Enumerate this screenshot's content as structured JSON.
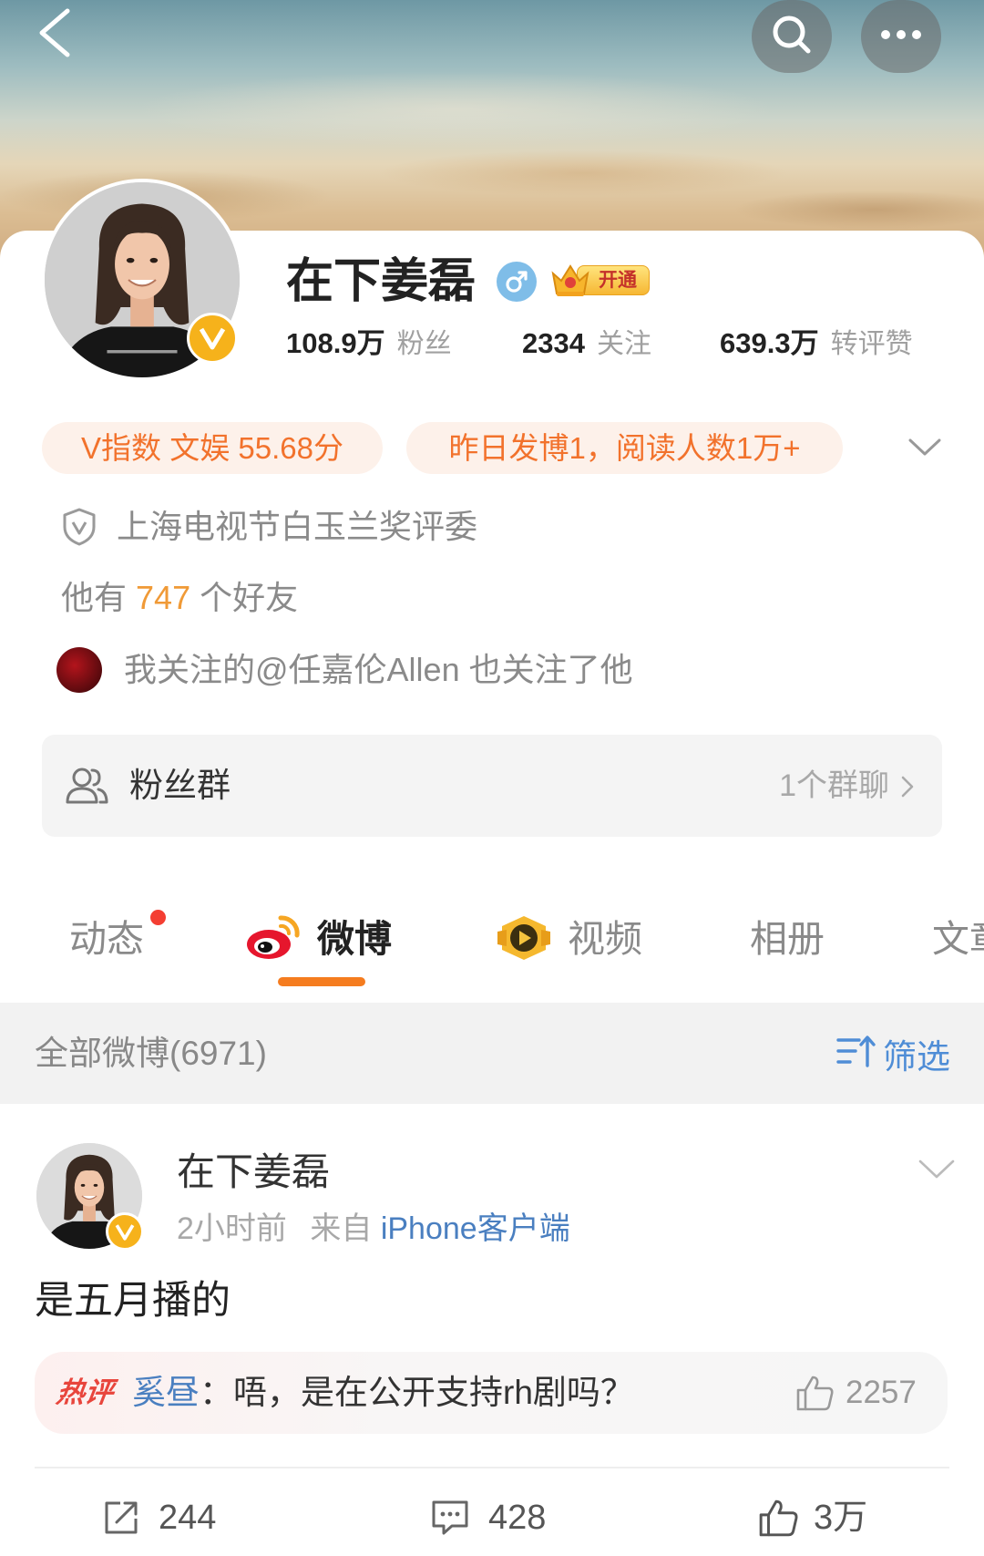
{
  "header": {
    "icons": {
      "back": "chevron-left-icon",
      "search": "search-icon",
      "more": "more-dots-icon"
    }
  },
  "profile": {
    "name": "在下姜磊",
    "verified_icon": "verified-v-icon",
    "gender_icon": "male-icon",
    "vip_badge": {
      "icon": "crown-icon",
      "label": "开通"
    },
    "stats": [
      {
        "value": "108.9万",
        "label": "粉丝"
      },
      {
        "value": "2334",
        "label": "关注"
      },
      {
        "value": "639.3万",
        "label": "转评赞"
      }
    ]
  },
  "tags": [
    {
      "text": "V指数 文娱 55.68分"
    },
    {
      "text": "昨日发博1，阅读人数1万+"
    }
  ],
  "expand_icon": "chevron-down-icon",
  "certification": {
    "icon": "shield-v-icon",
    "text": "上海电视节白玉兰奖评委"
  },
  "friends": {
    "prefix": "他有",
    "count": "747",
    "suffix": "个好友"
  },
  "mutual_follow": {
    "text": "我关注的@任嘉伦Allen 也关注了他"
  },
  "fan_group": {
    "icon": "group-icon",
    "label": "粉丝群",
    "count": "1个群聊"
  },
  "tabs": [
    {
      "label": "动态",
      "badge_dot": true
    },
    {
      "label": "微博",
      "icon": "weibo-logo-icon",
      "active": true
    },
    {
      "label": "视频",
      "icon": "video-icon"
    },
    {
      "label": "相册"
    },
    {
      "label": "文章"
    }
  ],
  "feed_bar": {
    "title": "全部微博(6971)",
    "filter_icon": "filter-icon",
    "filter_label": "筛选"
  },
  "post": {
    "author": "在下姜磊",
    "time": "2小时前",
    "source_prefix": "来自",
    "source": "iPhone客户端",
    "text": "是五月播的",
    "hot_comment": {
      "tag": "热评",
      "user": "奚昼",
      "text": "：唔，是在公开支持rh剧吗？",
      "likes": "2257"
    },
    "actions": {
      "reposts": "244",
      "comments": "428",
      "likes": "3万"
    }
  },
  "colors": {
    "accent_orange": "#f57c1f",
    "tag_text": "#f2722c",
    "tag_bg": "#fdf1ea",
    "link_blue": "#4a7fc0",
    "filter_blue": "#4f8dd6",
    "highlight_orange": "#f09a37",
    "badge_red": "#f43e32",
    "hot_red": "#e8453c"
  }
}
